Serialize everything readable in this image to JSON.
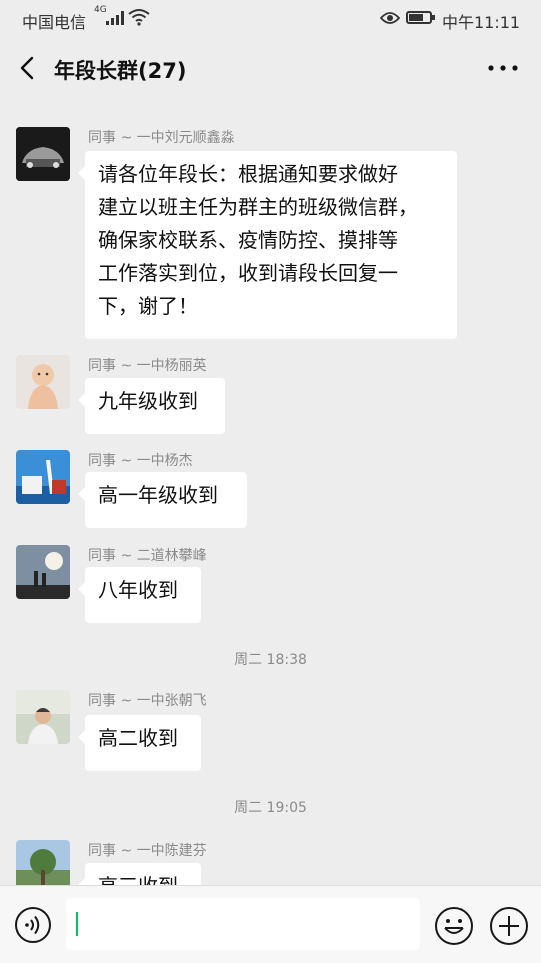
{
  "status_bar": {
    "carrier": "中国电信",
    "network": "4G",
    "time": "中午11:11"
  },
  "header": {
    "title": "年段长群(27)"
  },
  "messages": [
    {
      "sender": "同事 ~ 一中刘元顺鑫淼",
      "lines": [
        "请各位年段长：根据通知要求做好",
        "建立以班主任为群主的班级微信群，",
        "确保家校联系、疫情防控、摸排等",
        "工作落实到位，收到请段长回复一",
        "下，谢了！"
      ]
    },
    {
      "sender": "同事 ~ 一中杨丽英",
      "text": "九年级收到"
    },
    {
      "sender": "同事 ~ 一中杨杰",
      "text": "高一年级收到"
    },
    {
      "sender": "同事 ~ 二道林攀峰",
      "text": "八年收到"
    },
    {
      "sender": "同事 ~ 一中张朝飞",
      "text": "高二收到"
    },
    {
      "sender": "同事 ~ 一中陈建芬",
      "text": "高三收到"
    }
  ],
  "timestamps": [
    "周二 18:38",
    "周二 19:05"
  ],
  "input": {
    "value": ""
  },
  "icons": [
    "back-icon",
    "more-icon",
    "voice-icon",
    "emoji-icon",
    "plus-icon"
  ]
}
